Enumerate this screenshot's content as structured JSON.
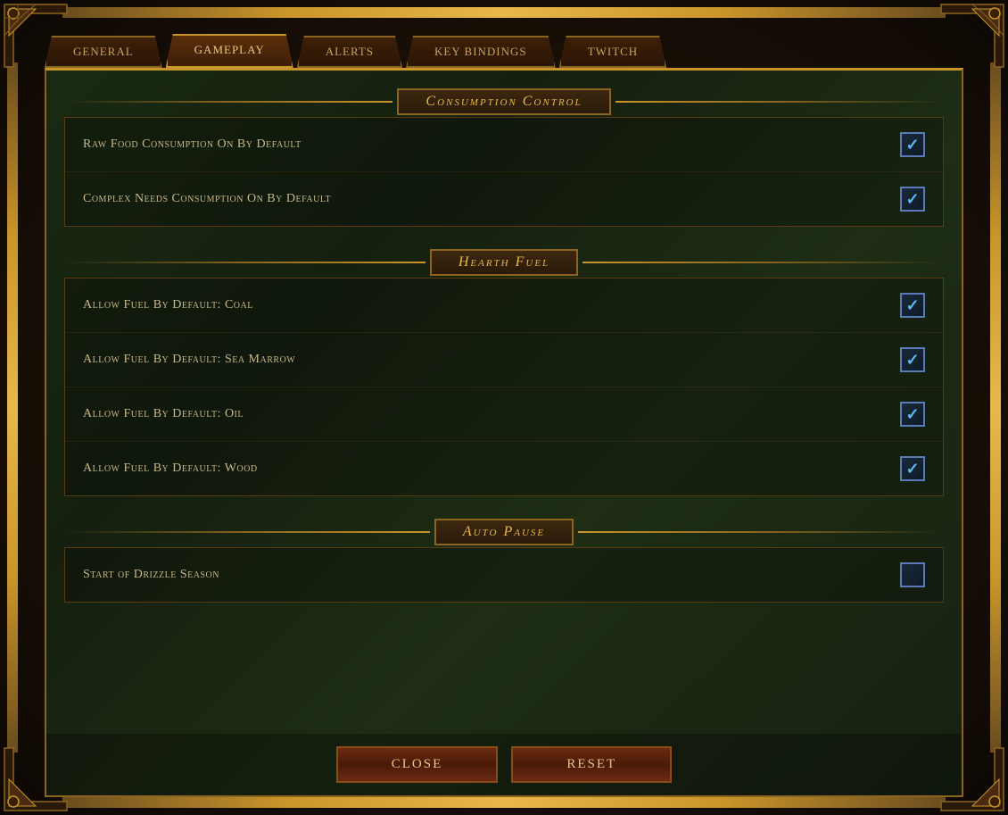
{
  "tabs": [
    {
      "id": "general",
      "label": "General",
      "active": false
    },
    {
      "id": "gameplay",
      "label": "Gameplay",
      "active": true
    },
    {
      "id": "alerts",
      "label": "Alerts",
      "active": false
    },
    {
      "id": "key_bindings",
      "label": "Key Bindings",
      "active": false
    },
    {
      "id": "twitch",
      "label": "TwITch",
      "active": false
    }
  ],
  "sections": [
    {
      "id": "consumption_control",
      "title": "Consumption Control",
      "settings": [
        {
          "id": "raw_food",
          "label": "Raw Food Consumption On By Default",
          "checked": true
        },
        {
          "id": "complex_needs",
          "label": "Complex Needs Consumption On By Default",
          "checked": true
        }
      ]
    },
    {
      "id": "hearth_fuel",
      "title": "Hearth Fuel",
      "settings": [
        {
          "id": "fuel_coal",
          "label": "Allow Fuel By Default: Coal",
          "checked": true
        },
        {
          "id": "fuel_sea_marrow",
          "label": "Allow Fuel By Default: Sea Marrow",
          "checked": true
        },
        {
          "id": "fuel_oil",
          "label": "Allow Fuel By Default: Oil",
          "checked": true
        },
        {
          "id": "fuel_wood",
          "label": "Allow Fuel By Default: Wood",
          "checked": true
        }
      ]
    },
    {
      "id": "auto_pause",
      "title": "Auto Pause",
      "settings": [
        {
          "id": "drizzle_season",
          "label": "Start of Drizzle Season",
          "checked": false
        }
      ]
    }
  ],
  "buttons": {
    "close": "Close",
    "reset": "Reset"
  },
  "colors": {
    "accent": "#e8b84a",
    "text": "#c8b888",
    "checkbox_checked": "#60b8e8",
    "border": "#8b6520"
  }
}
